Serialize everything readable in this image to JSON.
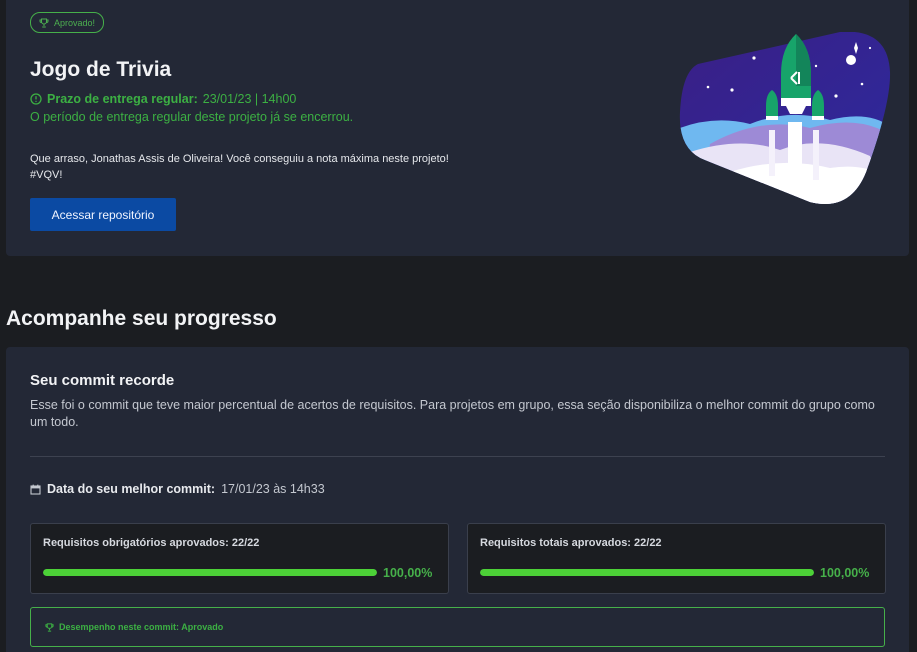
{
  "project": {
    "badge": "Aprovado!",
    "title": "Jogo de Trivia",
    "deadline_label": "Prazo de entrega regular:",
    "deadline_value": "23/01/23 | 14h00",
    "closed_message": "O período de entrega regular deste projeto já se encerrou.",
    "congrats_line1": "Que arraso, Jonathas Assis de Oliveira! Você conseguiu a nota máxima neste projeto!",
    "congrats_line2": "#VQV!",
    "repo_button": "Acessar repositório"
  },
  "progress": {
    "section_title": "Acompanhe seu progresso",
    "subtitle": "Seu commit recorde",
    "description": "Esse foi o commit que teve maior percentual de acertos de requisitos. Para projetos em grupo, essa seção disponibiliza o melhor commit do grupo como um todo.",
    "best_commit_label": "Data do seu melhor commit:",
    "best_commit_value": "17/01/23 às 14h33",
    "mandatory": {
      "label": "Requisitos obrigatórios aprovados: 22/22",
      "percent_text": "100,00%",
      "fraction": 1.0
    },
    "total": {
      "label": "Requisitos totais aprovados: 22/22",
      "percent_text": "100,00%",
      "fraction": 1.0
    },
    "performance": "Desempenho neste commit: Aprovado"
  },
  "colors": {
    "accent_green": "#3cb043",
    "button_blue": "#0b4aa3",
    "progress_fill": "#4cd137"
  },
  "icons": {
    "badge": "trophy-icon",
    "deadline": "clock-icon",
    "best_commit": "calendar-icon",
    "performance": "trophy-icon"
  }
}
